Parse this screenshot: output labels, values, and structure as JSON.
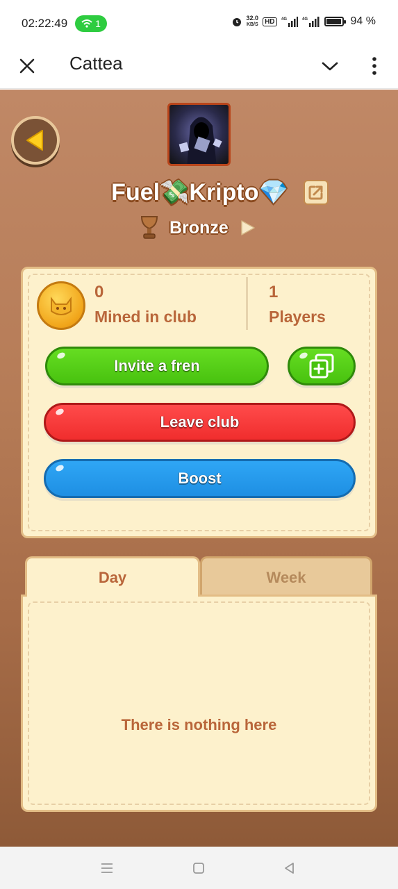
{
  "status_bar": {
    "time": "02:22:49",
    "hotspot_count": "1",
    "net_speed_value": "32.0",
    "net_speed_unit": "KB/S",
    "hd_label": "HD",
    "signal_1_label": "4G",
    "signal_2_label": "4G",
    "battery": "94 %"
  },
  "app_bar": {
    "title": "Cattea"
  },
  "club": {
    "name": "Fuel💸Kripto💎",
    "tier": "Bronze"
  },
  "stats": {
    "mined_value": "0",
    "mined_label": "Mined in club",
    "players_value": "1",
    "players_label": "Players"
  },
  "buttons": {
    "invite": "Invite a fren",
    "leave": "Leave club",
    "boost": "Boost"
  },
  "tabs": {
    "day": "Day",
    "week": "Week"
  },
  "list": {
    "empty": "There is nothing here"
  },
  "colors": {
    "accent_green": "#48c20f",
    "accent_red": "#f02d2d",
    "accent_blue": "#1e8fe3",
    "text_brown": "#b9663a"
  }
}
